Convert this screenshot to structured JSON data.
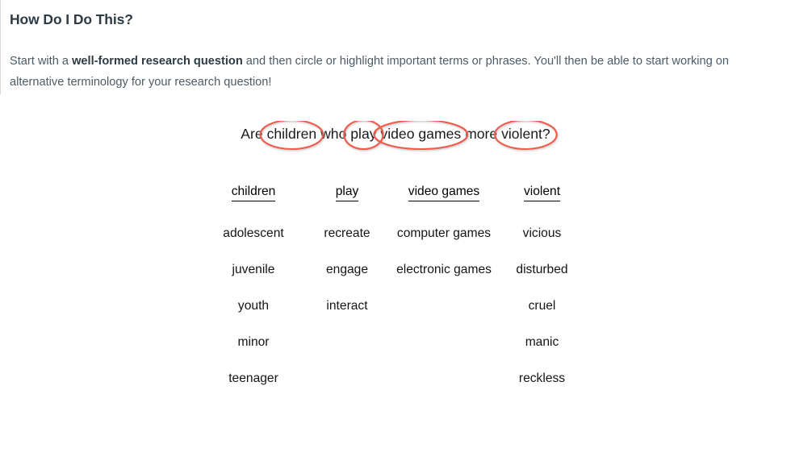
{
  "page": {
    "title": "How Do I Do This?",
    "intro": {
      "part1": "Start with a ",
      "bold": "well-formed research question",
      "part2": " and then circle or highlight important terms or phrases. You'll then be able to start working on alternative terminology for your research question!"
    }
  },
  "research_question": {
    "full_text": "Are children who play video games more violent?",
    "tokens": [
      {
        "text": "Are ",
        "circled": false
      },
      {
        "text": "children",
        "circled": true
      },
      {
        "text": " who ",
        "circled": false
      },
      {
        "text": "play",
        "circled": true
      },
      {
        "text": " ",
        "circled": false
      },
      {
        "text": "video games",
        "circled": true
      },
      {
        "text": " more ",
        "circled": false
      },
      {
        "text": "violent?",
        "circled": true
      }
    ],
    "circle_color": "#ef5a49"
  },
  "synonym_table": {
    "headers": [
      "children",
      "play",
      "video games",
      "violent"
    ],
    "rows": [
      [
        "adolescent",
        "recreate",
        "computer games",
        "vicious"
      ],
      [
        "juvenile",
        "engage",
        "electronic games",
        "disturbed"
      ],
      [
        "youth",
        "interact",
        "",
        "cruel"
      ],
      [
        "minor",
        "",
        "",
        "manic"
      ],
      [
        "teenager",
        "",
        "",
        "reckless"
      ]
    ]
  }
}
